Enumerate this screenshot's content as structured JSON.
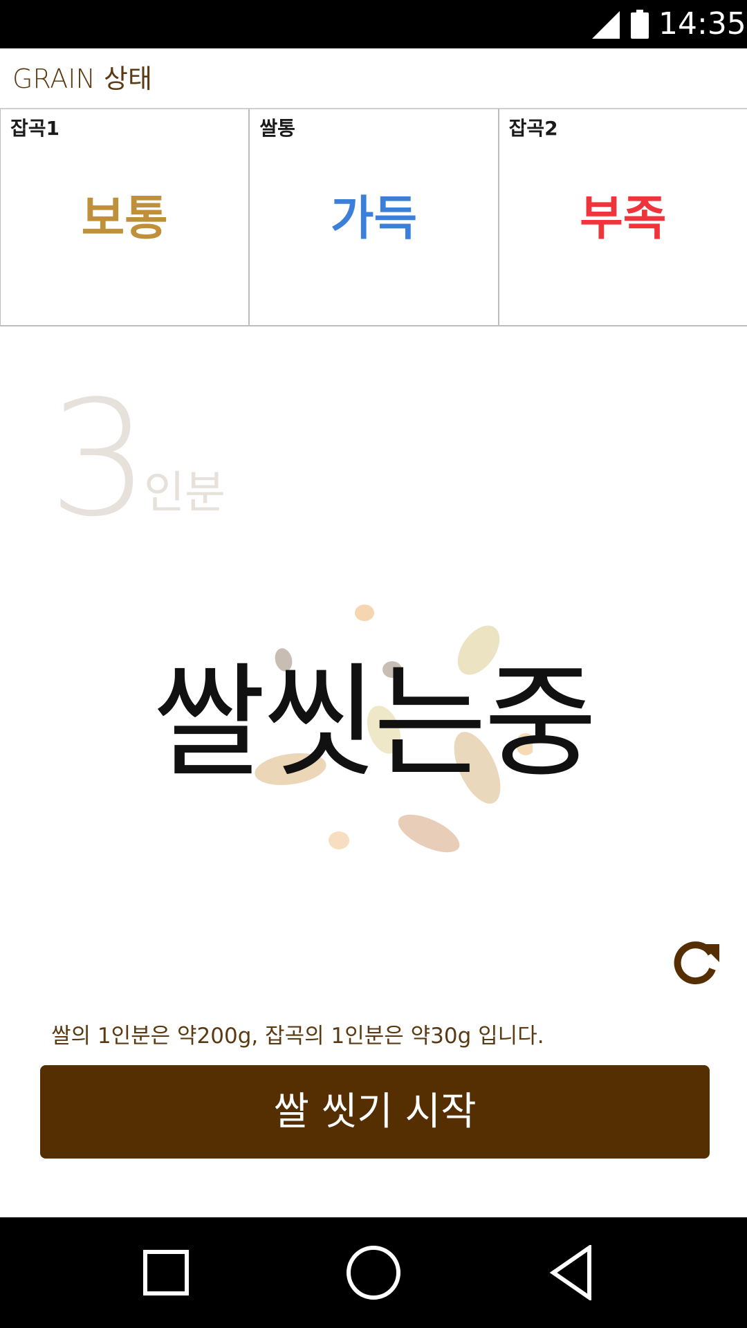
{
  "status_bar": {
    "time": "14:35",
    "icons": [
      "signal-icon",
      "battery-icon"
    ]
  },
  "header": {
    "title": "GRAIN 상태"
  },
  "grain_status": [
    {
      "label": "잡곡1",
      "value": "보통",
      "color": "#c08f3a"
    },
    {
      "label": "쌀통",
      "value": "가득",
      "color": "#3b7fd9"
    },
    {
      "label": "잡곡2",
      "value": "부족",
      "color": "#f0343b"
    }
  ],
  "portions": {
    "count": "3",
    "unit": "인분"
  },
  "main": {
    "status_text": "쌀씻는중"
  },
  "info_text": "쌀의 1인분은 약200g, 잡곡의 1인분은 약30g 입니다.",
  "start_button": {
    "label": "쌀 씻기 시작",
    "color": "#552e02"
  },
  "nav_bar": {
    "icons": [
      "recents-icon",
      "home-icon",
      "back-icon"
    ]
  },
  "colors": {
    "accent": "#552e02",
    "title_text": "#5a3a12",
    "portion_text": "#e6e1db"
  }
}
